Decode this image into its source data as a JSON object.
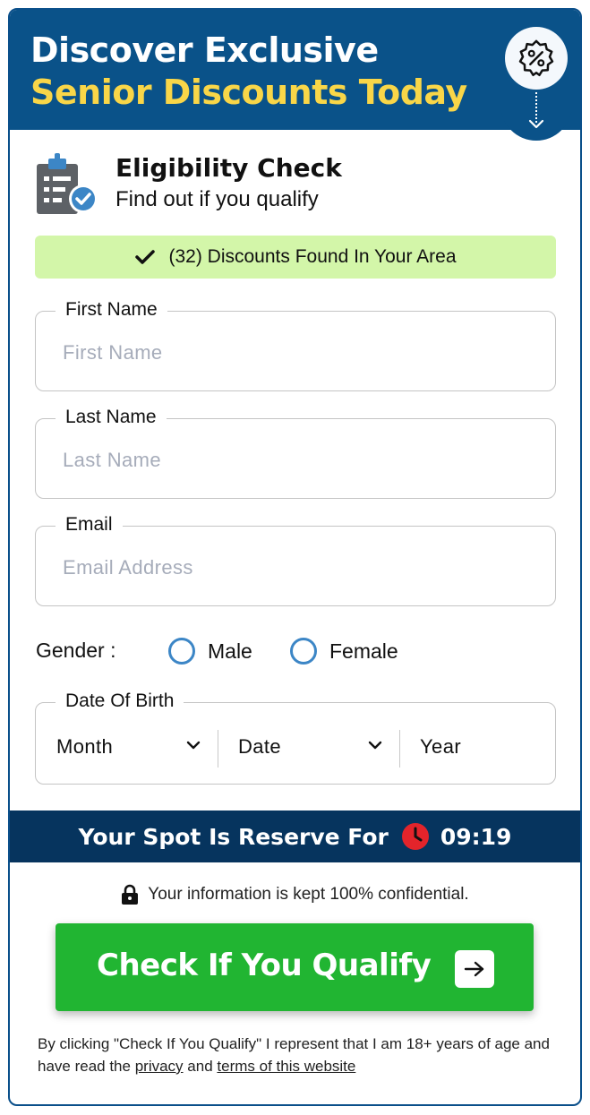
{
  "header": {
    "line1": "Discover Exclusive",
    "line2": "Senior Discounts Today",
    "badge_icon": "discount-badge-icon"
  },
  "eligibility": {
    "title": "Eligibility Check",
    "subtitle": "Find out if you qualify",
    "icon": "clipboard-check-icon"
  },
  "found_banner": {
    "text": "(32) Discounts Found In Your Area",
    "icon": "checkmark-icon"
  },
  "form": {
    "first_name": {
      "label": "First Name",
      "placeholder": "First Name",
      "value": ""
    },
    "last_name": {
      "label": "Last Name",
      "placeholder": "Last Name",
      "value": ""
    },
    "email": {
      "label": "Email",
      "placeholder": "Email Address",
      "value": ""
    },
    "gender": {
      "label": "Gender :",
      "options": [
        "Male",
        "Female"
      ]
    },
    "dob": {
      "label": "Date Of Birth",
      "month": "Month",
      "date": "Date",
      "year": "Year"
    }
  },
  "timer": {
    "text": "Your Spot Is Reserve For",
    "time": "09:19",
    "icon": "clock-icon"
  },
  "confidential": {
    "text": "Your information is kept 100% confidential.",
    "icon": "lock-icon"
  },
  "cta": {
    "label": "Check If You Qualify",
    "icon": "arrow-right-icon"
  },
  "legal": {
    "text_before": "By clicking \"Check If You Qualify\" I represent that I am 18+ years of age and have read the",
    "privacy_link": "privacy",
    "and": "and",
    "terms_link": "terms of this website"
  },
  "colors": {
    "header_blue": "#0a5289",
    "headline_yellow": "#f9d648",
    "banner_green": "#d3f6a9",
    "timer_navy": "#06345e",
    "cta_green": "#21b532",
    "radio_blue": "#3c86c6",
    "clock_red": "#e3242b"
  }
}
